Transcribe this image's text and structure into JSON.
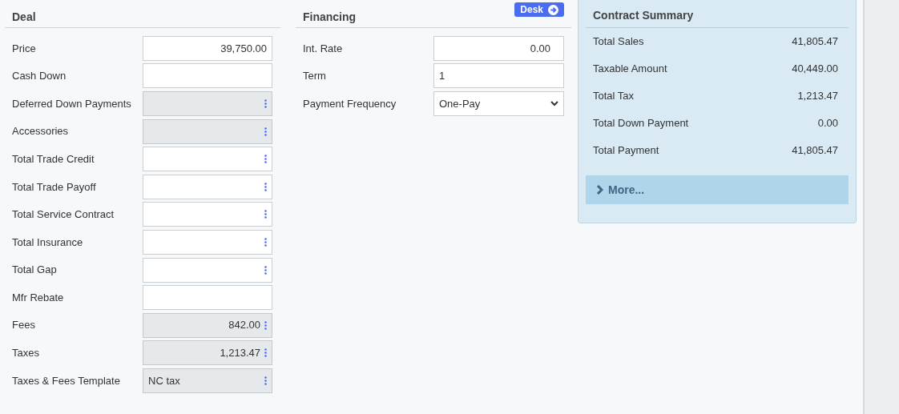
{
  "deal": {
    "title": "Deal",
    "fields": [
      {
        "label": "Price",
        "value": "39,750.00",
        "kind": "number",
        "disabled": false,
        "has_menu": false
      },
      {
        "label": "Cash Down",
        "kind": "number",
        "disabled": false,
        "has_menu": false
      },
      {
        "label": "Deferred Down Payments",
        "kind": "number",
        "disabled": true,
        "has_menu": true
      },
      {
        "label": "Accessories",
        "kind": "number",
        "disabled": true,
        "has_menu": true
      },
      {
        "label": "Total Trade Credit",
        "kind": "number",
        "disabled": false,
        "has_menu": true
      },
      {
        "label": "Total Trade Payoff",
        "kind": "number",
        "disabled": false,
        "has_menu": true
      },
      {
        "label": "Total Service Contract",
        "kind": "number",
        "disabled": false,
        "has_menu": true
      },
      {
        "label": "Total Insurance",
        "kind": "number",
        "disabled": false,
        "has_menu": true
      },
      {
        "label": "Total Gap",
        "kind": "number",
        "disabled": false,
        "has_menu": true
      },
      {
        "label": "Mfr Rebate",
        "kind": "number",
        "disabled": false,
        "has_menu": false
      },
      {
        "label": "Fees",
        "value": "842.00",
        "kind": "number",
        "disabled": true,
        "has_menu": true
      },
      {
        "label": "Taxes",
        "value": "1,213.47",
        "kind": "number",
        "disabled": true,
        "has_menu": true
      },
      {
        "label": "Taxes & Fees Template",
        "value": "NC tax",
        "kind": "text",
        "disabled": true,
        "has_menu": true
      }
    ]
  },
  "financing": {
    "title": "Financing",
    "desk_button": "Desk",
    "fields": [
      {
        "label": "Int. Rate",
        "kind": "number",
        "value": "0.00"
      },
      {
        "label": "Term",
        "kind": "text",
        "value": "1"
      },
      {
        "label": "Payment Frequency",
        "kind": "select",
        "value": "One-Pay"
      }
    ]
  },
  "contract_summary": {
    "title": "Contract Summary",
    "rows": [
      {
        "label": "Total Sales",
        "value": "41,805.47"
      },
      {
        "label": "Taxable Amount",
        "value": "40,449.00"
      },
      {
        "label": "Total Tax",
        "value": "1,213.47"
      },
      {
        "label": "Total Down Payment",
        "value": "0.00"
      },
      {
        "label": "Total Payment",
        "value": "41,805.47"
      }
    ],
    "more_button": "More...",
    "expanded": false
  }
}
